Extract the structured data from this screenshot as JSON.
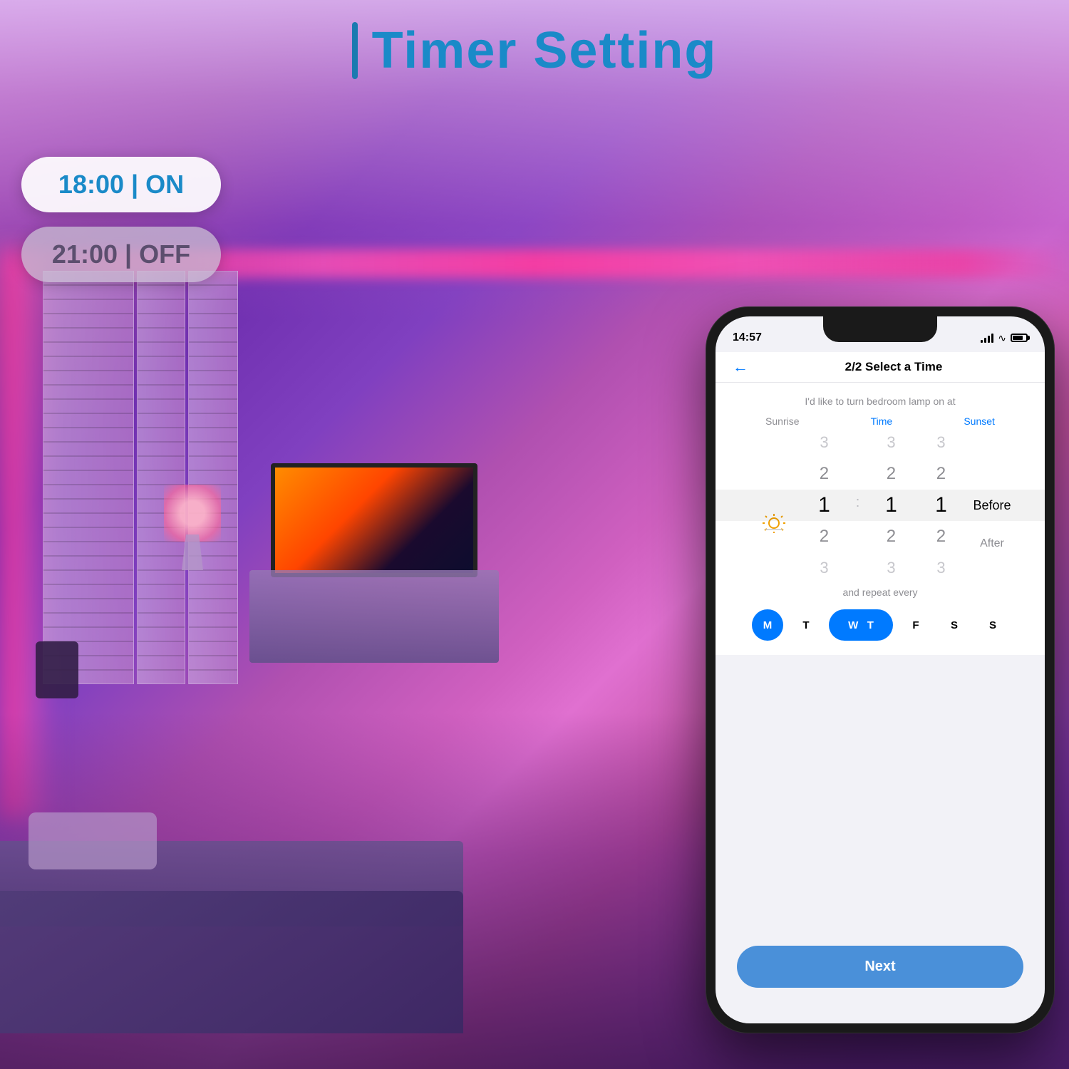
{
  "title": "Timer Setting",
  "title_accent": "I",
  "timer_on": "18:00 | ON",
  "timer_off": "21:00 | OFF",
  "phone": {
    "status_time": "14:57",
    "header_title": "2/2 Select a Time",
    "back_label": "←",
    "subtitle": "I'd like to turn bedroom lamp on at",
    "sunrise_label": "Sunrise",
    "time_label": "Time",
    "sunset_label": "Sunset",
    "picker": {
      "col1": [
        "3",
        "2",
        "1",
        "2",
        "3"
      ],
      "col2": [
        "3",
        "2",
        "1",
        "2",
        "3"
      ],
      "col3": [
        "3",
        "2",
        "1",
        "2",
        "3"
      ],
      "selected_index": 2,
      "before_after": [
        "Before",
        "After"
      ]
    },
    "repeat_label": "and repeat every",
    "days": [
      {
        "label": "M",
        "active": true
      },
      {
        "label": "T",
        "active": false
      },
      {
        "label": "W T",
        "active": true,
        "wide": true
      },
      {
        "label": "F",
        "active": false
      },
      {
        "label": "S",
        "active": false
      },
      {
        "label": "S",
        "active": false
      }
    ],
    "next_button": "Next"
  }
}
